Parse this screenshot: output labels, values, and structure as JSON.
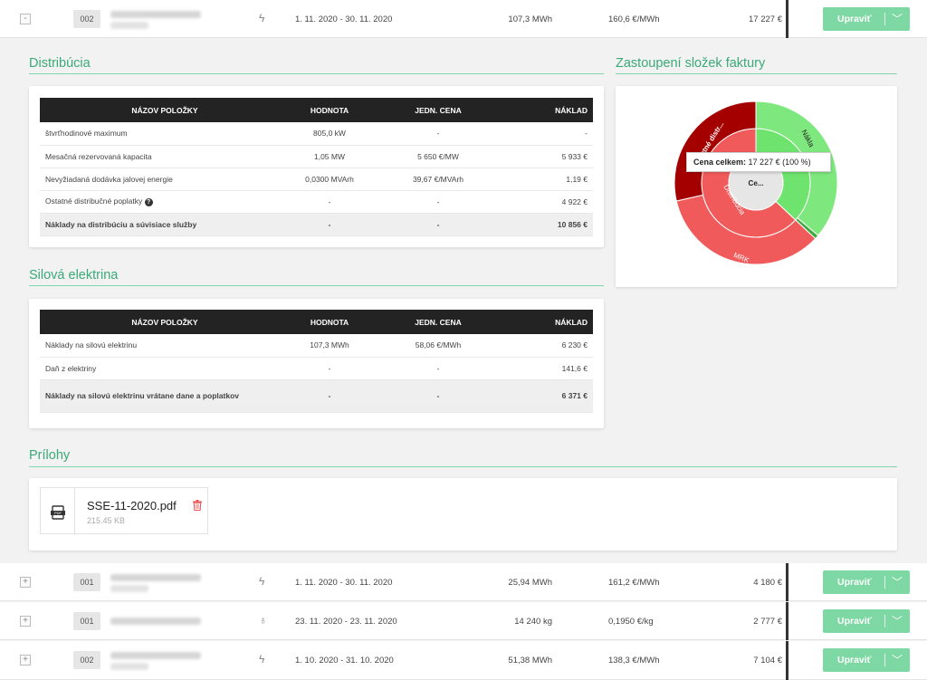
{
  "rows": [
    {
      "toggle": "-",
      "num": "002",
      "icon": "bolt-icon",
      "icon_char": "ϟ",
      "period": "1. 11. 2020 - 30. 11. 2020",
      "quantity": "107,3 MWh",
      "price": "160,6 €/MWh",
      "cost": "17 227 €",
      "edit": "Upraviť"
    },
    {
      "toggle": "+",
      "num": "001",
      "icon": "bolt-icon",
      "icon_char": "ϟ",
      "period": "1. 11. 2020 - 30. 11. 2020",
      "quantity": "25,94 MWh",
      "price": "161,2 €/MWh",
      "cost": "4 180 €",
      "edit": "Upraviť"
    },
    {
      "toggle": "+",
      "num": "001",
      "icon": "gas-flame-icon",
      "icon_char": "♁",
      "period": "23. 11. 2020 - 23. 11. 2020",
      "quantity": "14 240 kg",
      "price": "0,1950 €/kg",
      "cost": "2 777 €",
      "edit": "Upraviť"
    },
    {
      "toggle": "+",
      "num": "002",
      "icon": "bolt-icon",
      "icon_char": "ϟ",
      "period": "1. 10. 2020 - 31. 10. 2020",
      "quantity": "51,38 MWh",
      "price": "138,3 €/MWh",
      "cost": "7 104 €",
      "edit": "Upraviť"
    }
  ],
  "distribucia": {
    "title": "Distribúcia",
    "headers": [
      "NÁZOV POLOŽKY",
      "HODNOTA",
      "JEDN. CENA",
      "NÁKLAD"
    ],
    "rows": [
      [
        "štvrťhodinové maximum",
        "805,0 kW",
        "-",
        "-"
      ],
      [
        "Mesačná rezervovaná kapacita",
        "1,05 MW",
        "5 650 €/MW",
        "5 933 €"
      ],
      [
        "Nevyžiadaná dodávka jalovej energie",
        "0,0300 MVArh",
        "39,67 €/MVArh",
        "1,19 €"
      ],
      [
        "Ostatné distribučné poplatky",
        "-",
        "-",
        "4 922 €"
      ]
    ],
    "total": [
      "Náklady na distribúciu a súvisiace služby",
      "-",
      "-",
      "10 856 €"
    ]
  },
  "silova": {
    "title": "Silová elektrina",
    "headers": [
      "NÁZOV POLOŽKY",
      "HODNOTA",
      "JEDN. CENA",
      "NÁKLAD"
    ],
    "rows": [
      [
        "Náklady na silovú elektrinu",
        "107,3 MWh",
        "58,06 €/MWh",
        "6 230 €"
      ],
      [
        "Daň z elektriny",
        "-",
        "-",
        "141,6 €"
      ]
    ],
    "total": [
      "Náklady na silovú elektrinu vrátane dane a poplatkov",
      "-",
      "-",
      "6 371 €"
    ]
  },
  "prilohy": {
    "title": "Prílohy",
    "file_name": "SSE-11-2020.pdf",
    "file_size": "215.45 KB"
  },
  "chart_title": "Zastoupení složek faktury",
  "chart_data": {
    "type": "pie",
    "subtype": "sunburst",
    "total_value": 17227,
    "center_label": "Ce...",
    "tooltip_label": "Cena celkem:",
    "tooltip_value": "17 227 € (100 %)",
    "inner": [
      {
        "label": "Distribúcia",
        "value": 10856,
        "color": "#f15a5a"
      },
      {
        "label": "Silová elektrina",
        "value": 6371,
        "color": "#6ee36e"
      }
    ],
    "outer": [
      {
        "label": "MRK",
        "value": 5933,
        "color": "#f15a5a"
      },
      {
        "label": "Ostatné distr...",
        "value": 4922,
        "color": "#a50000"
      },
      {
        "label": "Nákl...",
        "value": 6230,
        "color": "#7ee87e"
      },
      {
        "label": "",
        "value": 142,
        "color": "#3fa83f"
      }
    ],
    "ring_labels": [
      "Distribúcia",
      "MRK",
      "Ostatné distr...",
      "Náklady na silovú elektrinu"
    ]
  }
}
